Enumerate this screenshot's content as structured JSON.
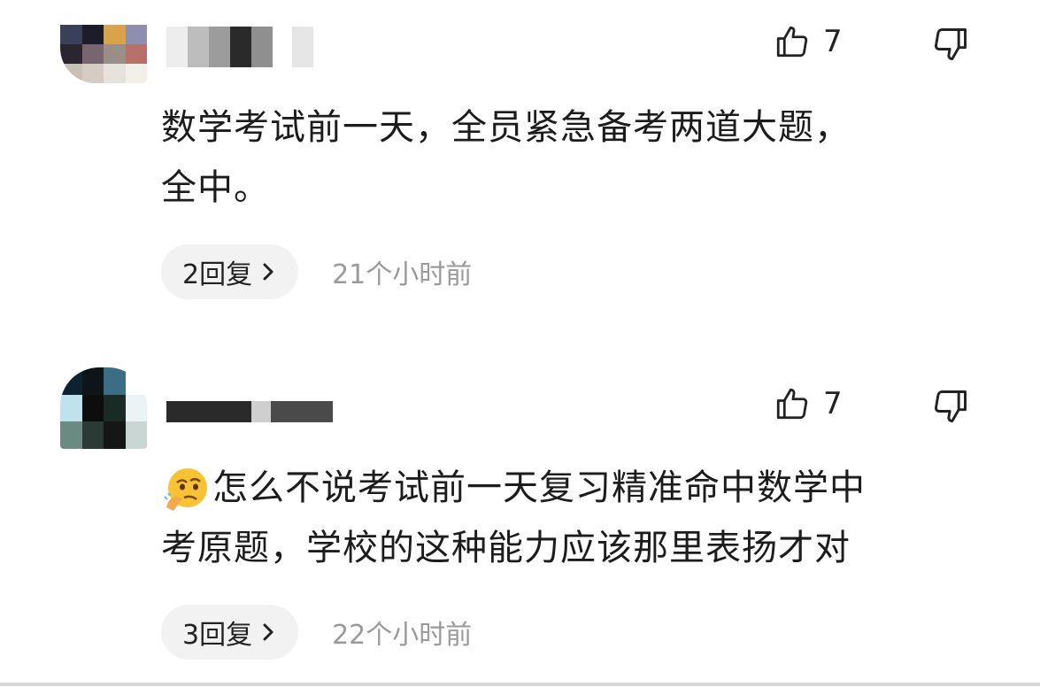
{
  "comments": [
    {
      "likes": "7",
      "text_lines": [
        "数学考试前一天，全员紧急备考两道大题，",
        "全中。"
      ],
      "reply_label": "2回复",
      "time": "21个小时前"
    },
    {
      "likes": "7",
      "emoji": "thinking-face-icon",
      "text_lines": [
        "怎么不说考试前一天复习精准命中数学中",
        "考原题，学校的这种能力应该那里表扬才对"
      ],
      "reply_label": "3回复",
      "time": "22个小时前"
    }
  ],
  "colors": {
    "meta_text": "#9a9a9a",
    "reply_bg": "#f2f2f2",
    "text": "#1c1c1c"
  }
}
